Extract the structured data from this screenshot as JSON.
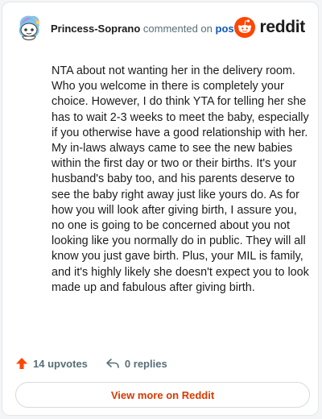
{
  "header": {
    "author": "Princess-Soprano",
    "action_text": "commented on",
    "post_link": "post",
    "brand": "reddit"
  },
  "comment": {
    "text": "NTA about not wanting her in the delivery room. Who you welcome in there is completely your choice. However, I do think YTA for telling her she has to wait 2-3 weeks to meet the baby, especially if you otherwise have a good relationship with her. My in-laws always came to see the new babies within the first day or two or their births. It's your husband's baby too, and his parents deserve to see the baby right away just like yours do. As for how you will look after giving birth, I assure you, no one is going to be concerned about you not looking like you normally do in public. They will all know you just gave birth. Plus, your MIL is family, and it's highly likely she doesn't expect you to look made up and fabulous after giving birth."
  },
  "actions": {
    "upvotes": "14 upvotes",
    "replies": "0 replies"
  },
  "footer": {
    "view_more": "View more on Reddit"
  },
  "colors": {
    "brand_orange": "#ff4500",
    "link_blue": "#0a58b8",
    "view_more": "#d93a00"
  },
  "icons": {
    "avatar": "snoo-avatar",
    "brand": "reddit-logo-icon",
    "upvote": "upvote-arrow-icon",
    "reply": "reply-arrow-icon"
  }
}
